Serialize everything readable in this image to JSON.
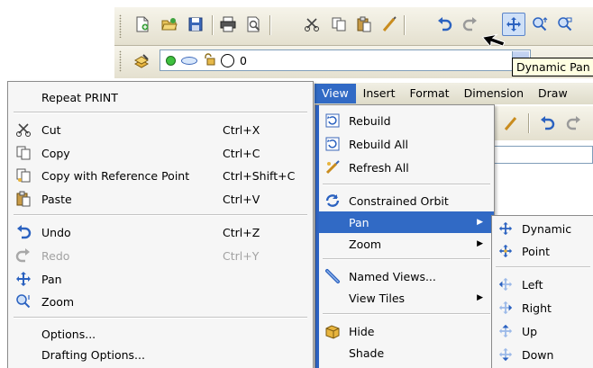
{
  "toolbar": {
    "icons": [
      "new-drawing-icon",
      "open-icon",
      "save-icon",
      "print-icon",
      "print-preview-icon",
      "cut-icon",
      "copy-icon",
      "paste-icon",
      "match-properties-icon",
      "undo-icon",
      "redo-icon",
      "pan-realtime-icon",
      "zoom-realtime-icon",
      "zoom-window-icon"
    ],
    "active_icon": "pan-realtime-icon"
  },
  "layer_bar": {
    "layer_name": "0",
    "icons": [
      "layer-manager-icon",
      "bulb-on-icon",
      "freeze-icon",
      "lock-icon",
      "color-swatch-icon"
    ]
  },
  "tooltip": {
    "text": "Dynamic Pan"
  },
  "context_menu": {
    "items": [
      {
        "label": "Repeat PRINT",
        "shortcut": ""
      },
      {
        "label": "Cut",
        "shortcut": "Ctrl+X"
      },
      {
        "label": "Copy",
        "shortcut": "Ctrl+C"
      },
      {
        "label": "Copy with Reference Point",
        "shortcut": "Ctrl+Shift+C"
      },
      {
        "label": "Paste",
        "shortcut": "Ctrl+V"
      },
      {
        "label": "Undo",
        "shortcut": "Ctrl+Z"
      },
      {
        "label": "Redo",
        "shortcut": "Ctrl+Y"
      },
      {
        "label": "Pan",
        "shortcut": ""
      },
      {
        "label": "Zoom",
        "shortcut": ""
      },
      {
        "label": "Options...",
        "shortcut": ""
      },
      {
        "label": "Drafting Options...",
        "shortcut": ""
      }
    ]
  },
  "menubar": {
    "items": [
      "View",
      "Insert",
      "Format",
      "Dimension",
      "Draw"
    ],
    "open": "View"
  },
  "view_menu": {
    "items": [
      {
        "label": "Rebuild"
      },
      {
        "label": "Rebuild All"
      },
      {
        "label": "Refresh All"
      },
      {
        "label": "Constrained Orbit"
      },
      {
        "label": "Pan"
      },
      {
        "label": "Zoom"
      },
      {
        "label": "Named Views..."
      },
      {
        "label": "View Tiles"
      },
      {
        "label": "Hide"
      },
      {
        "label": "Shade"
      }
    ],
    "highlighted": "Pan"
  },
  "pan_submenu": {
    "items": [
      {
        "label": "Dynamic"
      },
      {
        "label": "Point"
      },
      {
        "label": "Left"
      },
      {
        "label": "Right"
      },
      {
        "label": "Up"
      },
      {
        "label": "Down"
      }
    ]
  },
  "colors": {
    "highlight": "#316ac5",
    "menu_bg": "#f6f6f6",
    "toolbar_bg": "#ebe8d8",
    "tooltip_bg": "#ffffe1"
  }
}
